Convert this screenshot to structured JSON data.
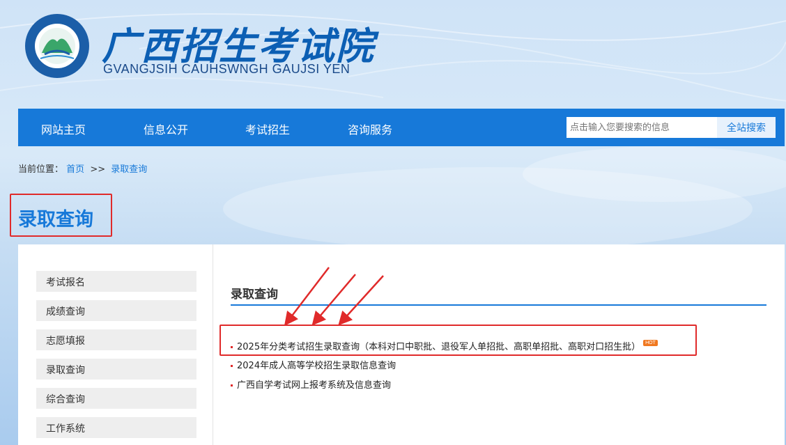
{
  "header": {
    "brand_cn": "广西招生考试院",
    "brand_en": "GVANGJSIH CAUHSWNGH GAUJSI YEN",
    "logo_ring_text": "GVANGJSIH CAUHSWNGH GAUJSI YEN"
  },
  "nav": {
    "items": [
      {
        "label": "网站主页"
      },
      {
        "label": "信息公开"
      },
      {
        "label": "考试招生"
      },
      {
        "label": "咨询服务"
      }
    ],
    "search_placeholder": "点击输入您要搜索的信息",
    "search_button": "全站搜索"
  },
  "breadcrumb": {
    "prefix": "当前位置：",
    "home": "首页",
    "sep": ">>",
    "current": "录取查询"
  },
  "page_title": "录取查询",
  "sidebar": {
    "items": [
      {
        "label": "考试报名"
      },
      {
        "label": "成绩查询"
      },
      {
        "label": "志愿填报"
      },
      {
        "label": "录取查询"
      },
      {
        "label": "综合查询"
      },
      {
        "label": "工作系统"
      }
    ]
  },
  "main": {
    "section_title": "录取查询",
    "links": [
      {
        "label": "2025年分类考试招生录取查询（本科对口中职批、退役军人单招批、高职单招批、高职对口招生批）",
        "badge": "HOT"
      },
      {
        "label": "2024年成人高等学校招生录取信息查询"
      },
      {
        "label": "广西自学考试网上报考系统及信息查询"
      }
    ]
  },
  "colors": {
    "accent": "#1779d9",
    "annotation": "#e02a2a",
    "hot_badge": "#f07820"
  }
}
